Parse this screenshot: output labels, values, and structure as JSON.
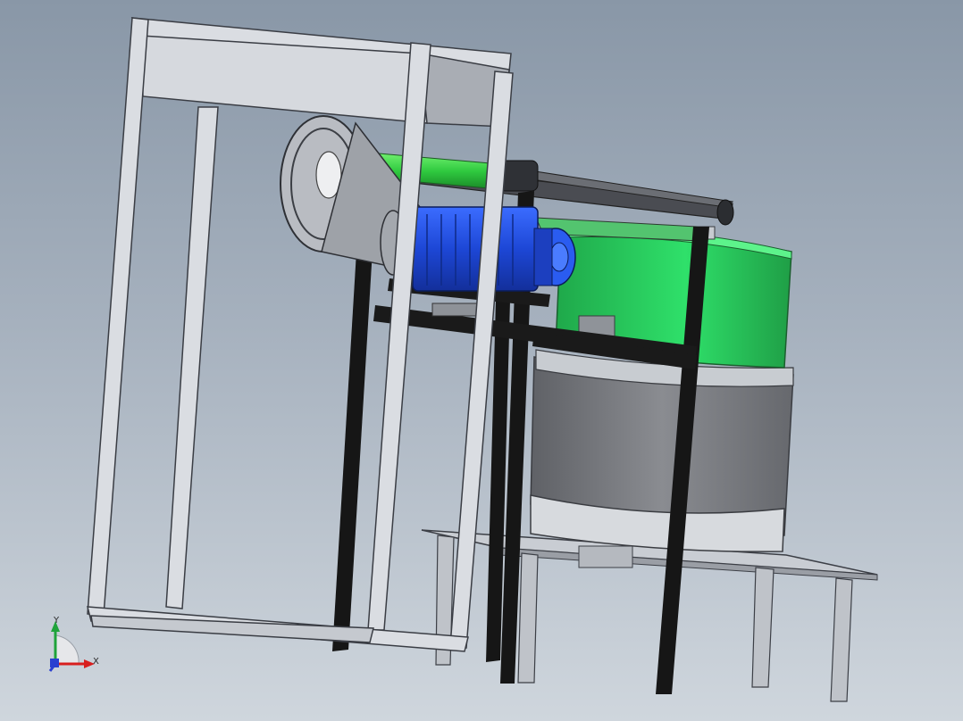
{
  "view": {
    "background_top": "#8997a7",
    "background_bottom": "#cfd6dd"
  },
  "triad": {
    "y_label": "Y",
    "x_label": "X",
    "y_color": "#1fa33a",
    "x_color": "#d81e1e",
    "z_color": "#2a3fd0"
  },
  "colors": {
    "frame_aluminum": "#dadde2",
    "frame_edge": "#3a3d44",
    "black_post": "#141414",
    "green_drum": "#27cf5c",
    "gray_drum": "#7b7d82",
    "motor_blue": "#1f4fe0",
    "shaft_green": "#39d84a"
  }
}
